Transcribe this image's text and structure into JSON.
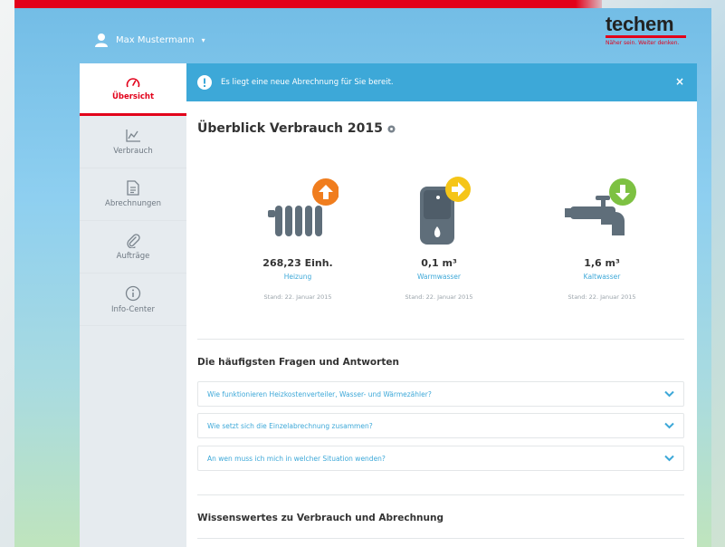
{
  "user": {
    "name": "Max Mustermann",
    "caret": "▾"
  },
  "brand": {
    "name": "techem",
    "tagline": "Näher sein. Weiter denken."
  },
  "sidebar": {
    "items": [
      {
        "label": "Übersicht",
        "icon": "gauge-icon",
        "active": true
      },
      {
        "label": "Verbrauch",
        "icon": "chart-line-icon",
        "active": false
      },
      {
        "label": "Abrechnungen",
        "icon": "document-icon",
        "active": false
      },
      {
        "label": "Aufträge",
        "icon": "paperclip-icon",
        "active": false
      },
      {
        "label": "Info-Center",
        "icon": "info-icon",
        "active": false
      }
    ]
  },
  "alert": {
    "text": "Es liegt eine neue Abrechnung für Sie bereit.",
    "close": "×"
  },
  "overview": {
    "title": "Überblick Verbrauch 2015",
    "metrics": [
      {
        "value": "268,23 Einh.",
        "label": "Heizung",
        "date": "Stand: 22. Januar 2015",
        "trend": "up",
        "badge_color": "#f07d1e"
      },
      {
        "value": "0,1 m³",
        "label": "Warmwasser",
        "date": "Stand: 22. Januar 2015",
        "trend": "right",
        "badge_color": "#f5c518"
      },
      {
        "value": "1,6 m³",
        "label": "Kaltwasser",
        "date": "Stand: 22. Januar 2015",
        "trend": "down",
        "badge_color": "#7dc142"
      }
    ]
  },
  "faq": {
    "title": "Die häufigsten Fragen und Antworten",
    "items": [
      "Wie funktionieren Heizkostenverteiler, Wasser- und Wärmezähler?",
      "Wie setzt sich die Einzelabrechnung zusammen?",
      "An wen muss ich mich in welcher Situation wenden?"
    ]
  },
  "info": {
    "title": "Wissenswertes zu Verbrauch und Abrechnung"
  },
  "colors": {
    "brand_red": "#e2001a",
    "accent_blue": "#3da8d8",
    "icon_gray": "#5f6e7a"
  }
}
